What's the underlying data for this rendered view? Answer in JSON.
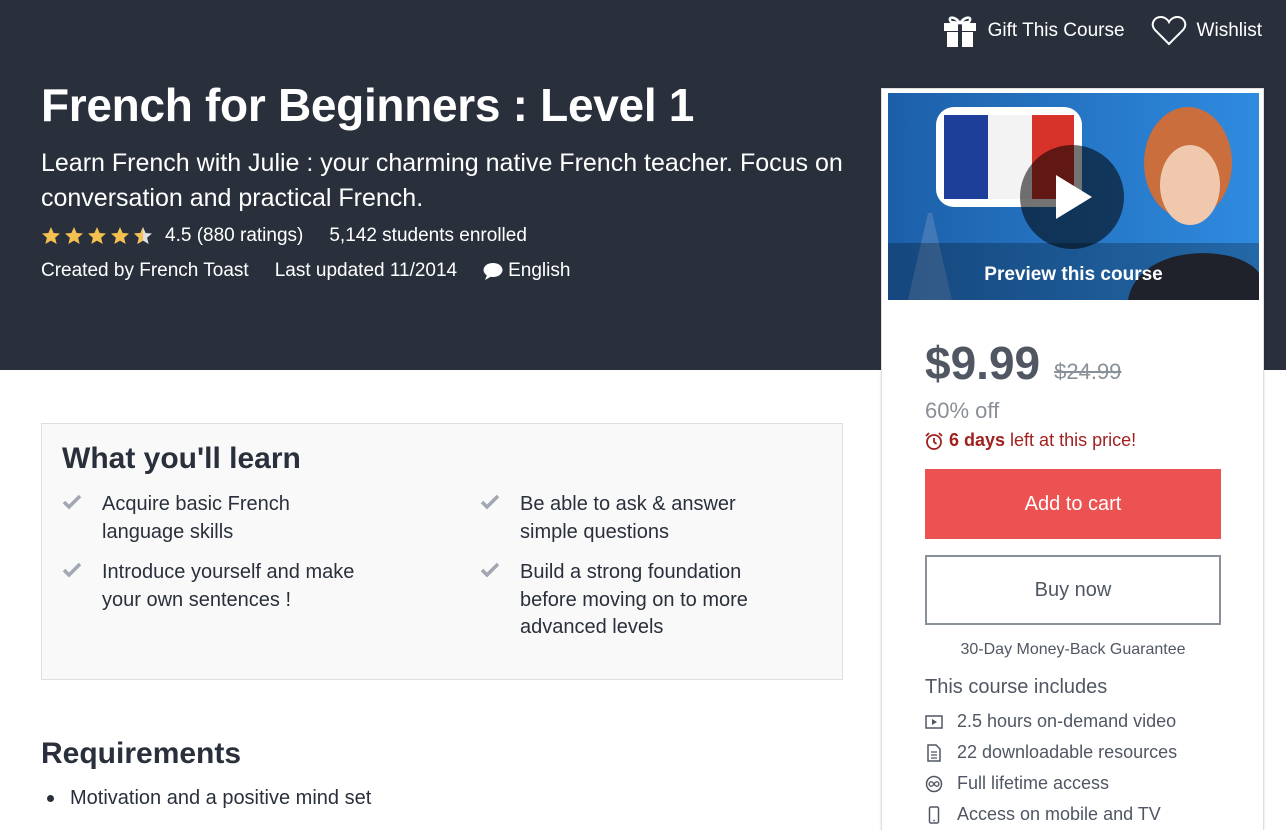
{
  "header": {
    "gift_label": "Gift This Course",
    "wishlist_label": "Wishlist"
  },
  "course": {
    "title": "French for Beginners : Level 1",
    "subtitle": "Learn French with Julie : your charming native French teacher. Focus on conversation and practical French.",
    "rating": 4.5,
    "rating_text": "4.5 (880 ratings)",
    "enrolled": "5,142 students enrolled",
    "created_by": "Created by French Toast",
    "last_updated": "Last updated 11/2014",
    "language": "English"
  },
  "sidebar": {
    "preview_label": "Preview this course",
    "price": "$9.99",
    "old_price": "$24.99",
    "discount": "60% off",
    "timer_bold": "6 days",
    "timer_rest": " left at this price!",
    "add_to_cart": "Add to cart",
    "buy_now": "Buy now",
    "guarantee": "30-Day Money-Back Guarantee",
    "includes_title": "This course includes",
    "includes": [
      {
        "icon": "video-icon",
        "label": "2.5 hours on-demand video"
      },
      {
        "icon": "file-icon",
        "label": "22 downloadable resources"
      },
      {
        "icon": "infinity-icon",
        "label": "Full lifetime access"
      },
      {
        "icon": "mobile-icon",
        "label": "Access on mobile and TV"
      }
    ]
  },
  "learn": {
    "title": "What you'll learn",
    "items": [
      "Acquire basic French language skills",
      "Be able to ask & answer simple questions",
      "Introduce yourself and make your own sentences !",
      "Build a strong foundation before moving on to more advanced levels"
    ]
  },
  "requirements": {
    "title": "Requirements",
    "items": [
      "Motivation and a positive mind set"
    ]
  },
  "colors": {
    "hero_bg": "#29303b",
    "cta": "#ec5252",
    "star": "#f4c150",
    "timer": "#a1211f"
  }
}
